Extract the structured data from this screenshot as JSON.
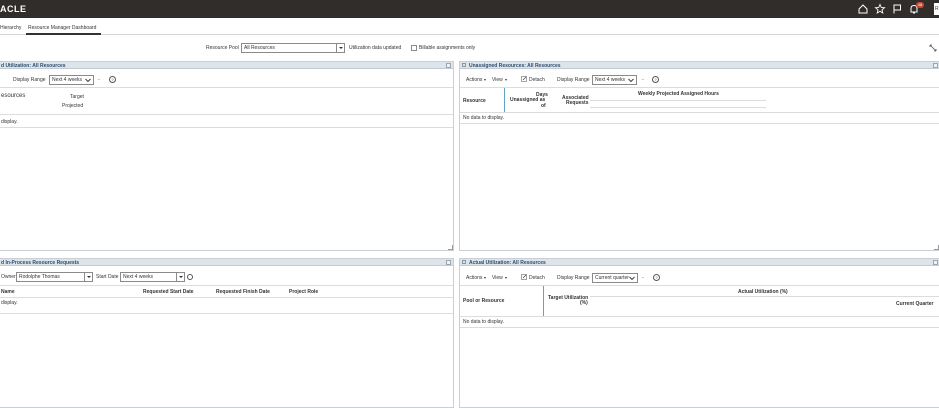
{
  "brand": "ACLE",
  "topbar": {
    "notification_count": "48",
    "user_initial": "R"
  },
  "tabs": [
    {
      "label": "Hierarchy"
    },
    {
      "label": "Resource Manager Dashboard"
    }
  ],
  "filters": {
    "resource_pool_label": "Resource Pool",
    "resource_pool_value": "All Resources",
    "util_updated_label": "Utilization data updated",
    "billable_label": "Billable assignments only"
  },
  "panels": {
    "projected": {
      "title": "d Utilization: All Resources",
      "display_range_label": "Display Range",
      "display_range_value": "Next 4 weeks",
      "dash": "-",
      "resources_label": "esources",
      "target_label": "Target",
      "projected_label": "Projected",
      "no_data": "display."
    },
    "unassigned": {
      "title": "Unassigned Resources: All Resources",
      "actions_label": "Actions",
      "view_label": "View",
      "detach_label": "Detach",
      "display_range_label": "Display Range",
      "display_range_value": "Next 4 weeks",
      "dash": "-",
      "col_resource": "Resource",
      "col_days_1": "Days",
      "col_days_2": "Unassigned as",
      "col_days_3": "of",
      "col_assoc_1": "Associated",
      "col_assoc_2": "Requests",
      "col_weekly": "Weekly Projected Assigned Hours",
      "no_data": "No data to display."
    },
    "requests": {
      "title": "d In-Process Resource Requests",
      "owner_label": "Owner",
      "owner_value": "Rodolphe Thomas",
      "start_date_label": "Start Date",
      "start_date_value": "Next 4 weeks",
      "col_name": "Name",
      "col_req_start": "Requested Start Date",
      "col_req_finish": "Requested Finish Date",
      "col_project_role": "Project Role",
      "no_data": "display."
    },
    "actual": {
      "title": "Actual Utilization: All Resources",
      "actions_label": "Actions",
      "view_label": "View",
      "detach_label": "Detach",
      "display_range_label": "Display Range",
      "display_range_value": "Current quarter",
      "dash": "-",
      "col_pool": "Pool or Resource",
      "col_target_1": "Target Utilization",
      "col_target_2": "(%)",
      "col_actual": "Actual Utilization (%)",
      "col_current_quarter": "Current Quarter",
      "no_data": "No data to display."
    }
  },
  "colors": {
    "topbar": "#312d2a",
    "panel_header": "#dde4ea",
    "panel_title": "#2e4e6e",
    "badge": "#c74634"
  }
}
